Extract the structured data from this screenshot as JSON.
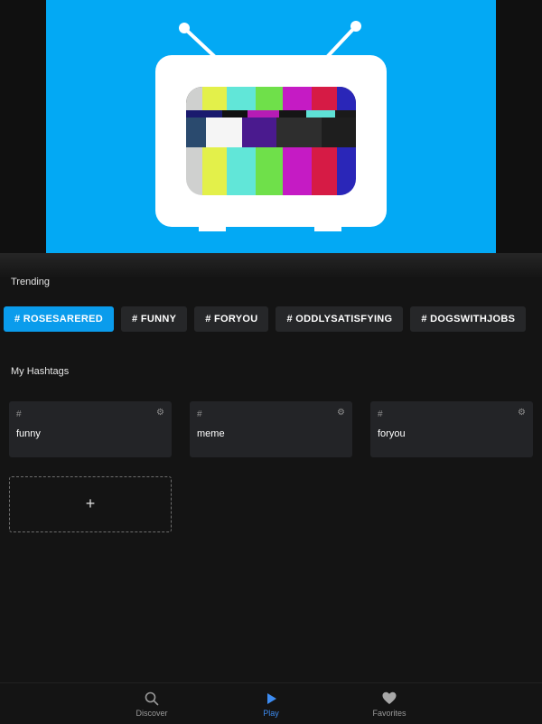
{
  "trending": {
    "title": "Trending",
    "chips": [
      {
        "label": "# ROSESARERED",
        "active": true
      },
      {
        "label": "# FUNNY",
        "active": false
      },
      {
        "label": "# FORYOU",
        "active": false
      },
      {
        "label": "# ODDLYSATISFYING",
        "active": false
      },
      {
        "label": "# DOGSWITHJOBS",
        "active": false
      }
    ]
  },
  "my_hashtags": {
    "title": "My Hashtags",
    "cards": [
      {
        "hash": "#",
        "name": "funny",
        "icon": "gear-icon"
      },
      {
        "hash": "#",
        "name": "meme",
        "icon": "gear-icon"
      },
      {
        "hash": "#",
        "name": "foryou",
        "icon": "gear-icon"
      }
    ],
    "add_label": "+"
  },
  "tabs": [
    {
      "label": "Discover",
      "icon": "search-icon",
      "active": false
    },
    {
      "label": "Play",
      "icon": "play-icon",
      "active": true
    },
    {
      "label": "Favorites",
      "icon": "heart-icon",
      "active": false
    }
  ],
  "colors": {
    "accent": "#0a9cec",
    "video_bg": "#03a9f4",
    "active_tab": "#3d8cf2",
    "background": "#141414"
  }
}
